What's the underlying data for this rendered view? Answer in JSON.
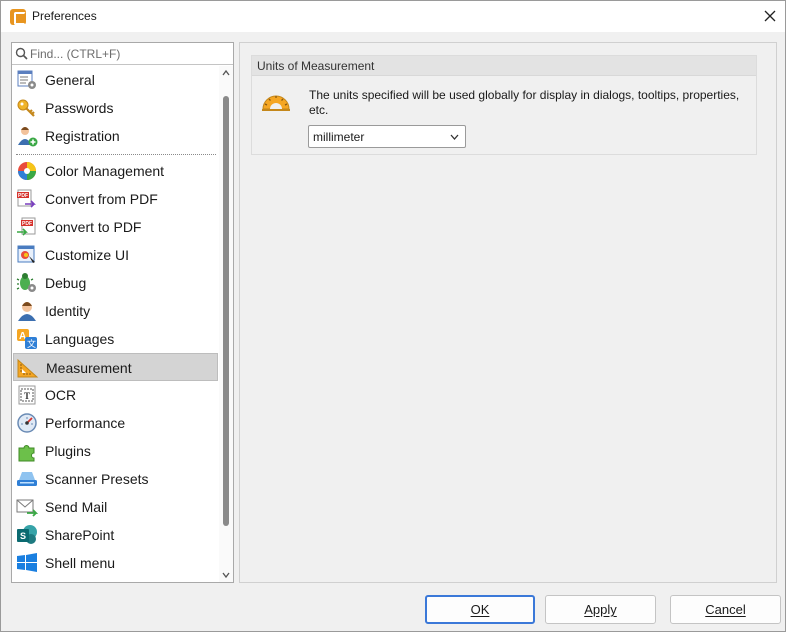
{
  "window": {
    "title": "Preferences"
  },
  "search": {
    "placeholder": "Find... (CTRL+F)"
  },
  "categories": [
    {
      "label": "General",
      "icon": "general-settings-icon"
    },
    {
      "label": "Passwords",
      "icon": "key-icon"
    },
    {
      "label": "Registration",
      "icon": "user-add-icon"
    },
    {
      "label": "Color Management",
      "icon": "color-wheel-icon"
    },
    {
      "label": "Convert from PDF",
      "icon": "pdf-export-icon"
    },
    {
      "label": "Convert to PDF",
      "icon": "pdf-import-icon"
    },
    {
      "label": "Customize UI",
      "icon": "customize-ui-icon"
    },
    {
      "label": "Debug",
      "icon": "bug-icon"
    },
    {
      "label": "Identity",
      "icon": "person-icon"
    },
    {
      "label": "Languages",
      "icon": "languages-icon"
    },
    {
      "label": "Measurement",
      "icon": "ruler-triangle-icon"
    },
    {
      "label": "OCR",
      "icon": "ocr-icon"
    },
    {
      "label": "Performance",
      "icon": "speedometer-icon"
    },
    {
      "label": "Plugins",
      "icon": "puzzle-icon"
    },
    {
      "label": "Scanner Presets",
      "icon": "scanner-icon"
    },
    {
      "label": "Send Mail",
      "icon": "mail-icon"
    },
    {
      "label": "SharePoint",
      "icon": "sharepoint-icon"
    },
    {
      "label": "Shell menu",
      "icon": "windows-icon"
    }
  ],
  "selected_category": "Measurement",
  "measurement": {
    "group_title": "Units of Measurement",
    "description": "The units specified will be used globally for display in dialogs, tooltips, properties, etc.",
    "units_value": "millimeter"
  },
  "buttons": {
    "ok": "OK",
    "apply": "Apply",
    "cancel": "Cancel"
  },
  "colors": {
    "selected_row": "#d4d4d4",
    "primary_border": "#3b78d8",
    "accent_orange": "#e8951f"
  }
}
